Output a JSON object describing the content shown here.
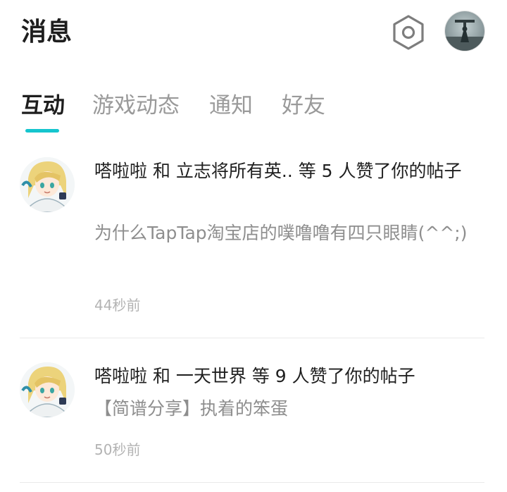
{
  "header": {
    "title": "消息",
    "settings_icon": "hexagon-gear-icon",
    "avatar_icon": "user-avatar"
  },
  "tabs": [
    {
      "label": "互动",
      "active": true
    },
    {
      "label": "游戏动态",
      "active": false
    },
    {
      "label": "通知",
      "active": false
    },
    {
      "label": "好友",
      "active": false
    }
  ],
  "accent_color": "#15c5ce",
  "messages": [
    {
      "title": "嗒啦啦 和 立志将所有英.. 等 5 人赞了你的帖子",
      "snippet": "为什么TapTap淘宝店的噗噜噜有四只眼睛(^^;)",
      "time": "44秒前"
    },
    {
      "title": "嗒啦啦 和 一天世界 等 9 人赞了你的帖子",
      "snippet": "【简谱分享】执着的笨蛋",
      "time": "50秒前"
    }
  ]
}
